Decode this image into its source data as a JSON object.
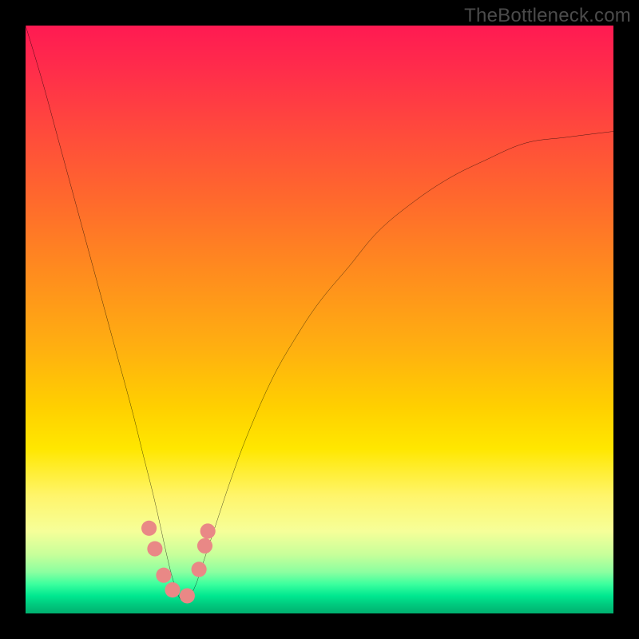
{
  "watermark": "TheBottleneck.com",
  "chart_data": {
    "type": "line",
    "title": "",
    "xlabel": "",
    "ylabel": "",
    "xlim": [
      0,
      100
    ],
    "ylim": [
      0,
      100
    ],
    "notes": "V-shaped bottleneck curve over red→green vertical gradient. Minimum near x≈26 at y≈2. Left branch reaches top-left corner; right branch rises toward upper-right, ending near y≈82 at x=100. Values are read off pixel positions (no axis ticks present).",
    "series": [
      {
        "name": "bottleneck-curve",
        "x": [
          0,
          3,
          6,
          9,
          12,
          15,
          18,
          20,
          22,
          24,
          25,
          26,
          27,
          28,
          29,
          30,
          32,
          35,
          38,
          42,
          46,
          50,
          55,
          60,
          66,
          72,
          78,
          85,
          92,
          100
        ],
        "values": [
          100,
          90,
          79,
          68,
          57,
          46,
          35,
          27,
          19,
          10,
          6,
          3,
          2,
          3,
          5,
          8,
          14,
          23,
          31,
          40,
          47,
          53,
          59,
          65,
          70,
          74,
          77,
          80,
          81,
          82
        ]
      }
    ],
    "markers": [
      {
        "x": 21.0,
        "y": 14.5
      },
      {
        "x": 22.0,
        "y": 11.0
      },
      {
        "x": 23.5,
        "y": 6.5
      },
      {
        "x": 25.0,
        "y": 4.0
      },
      {
        "x": 27.5,
        "y": 3.0
      },
      {
        "x": 29.5,
        "y": 7.5
      },
      {
        "x": 30.5,
        "y": 11.5
      },
      {
        "x": 31.0,
        "y": 14.0
      }
    ],
    "marker_radius_pct": 1.3,
    "gradient_stops": [
      {
        "pos": 0,
        "color": "#ff1a52"
      },
      {
        "pos": 30,
        "color": "#ff6a2c"
      },
      {
        "pos": 65,
        "color": "#ffd000"
      },
      {
        "pos": 86,
        "color": "#f6ff99"
      },
      {
        "pos": 95,
        "color": "#3cff9e"
      },
      {
        "pos": 100,
        "color": "#00b06f"
      }
    ]
  }
}
